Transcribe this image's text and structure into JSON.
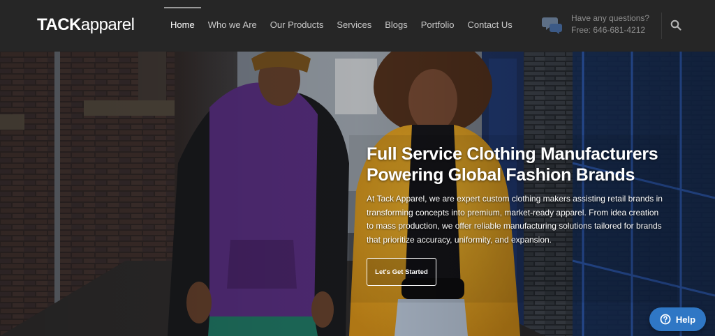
{
  "header": {
    "logo": {
      "bold": "TACK",
      "thin": "apparel"
    },
    "nav": [
      {
        "label": "Home",
        "active": true
      },
      {
        "label": "Who we Are",
        "active": false
      },
      {
        "label": "Our Products",
        "active": false
      },
      {
        "label": "Services",
        "active": false
      },
      {
        "label": "Blogs",
        "active": false
      },
      {
        "label": "Portfolio",
        "active": false
      },
      {
        "label": "Contact Us",
        "active": false
      }
    ],
    "contact": {
      "icon": "chat-bubbles-icon",
      "question": "Have any questions?",
      "phone": "Free: 646-681-4212"
    },
    "search_icon": "search-icon"
  },
  "hero": {
    "title_line1": "Full Service Clothing Manufacturers",
    "title_line2": "Powering Global Fashion Brands",
    "description": "At Tack Apparel, we are expert custom clothing makers assisting retail brands in transforming concepts into premium, market-ready apparel. From idea creation to mass production, we offer reliable manufacturing solutions tailored for brands that prioritize accuracy, uniformity, and expansion.",
    "cta_label": "Let's Get Started"
  },
  "help": {
    "label": "Help",
    "icon": "question-circle-icon"
  },
  "colors": {
    "header_bg": "#262626",
    "nav_active": "#ffffff",
    "nav_inactive": "#c9c9c9",
    "help_button": "#2f77c5",
    "hoodie_purple": "#4f2a73",
    "coat_yellow": "#d99b1e"
  }
}
